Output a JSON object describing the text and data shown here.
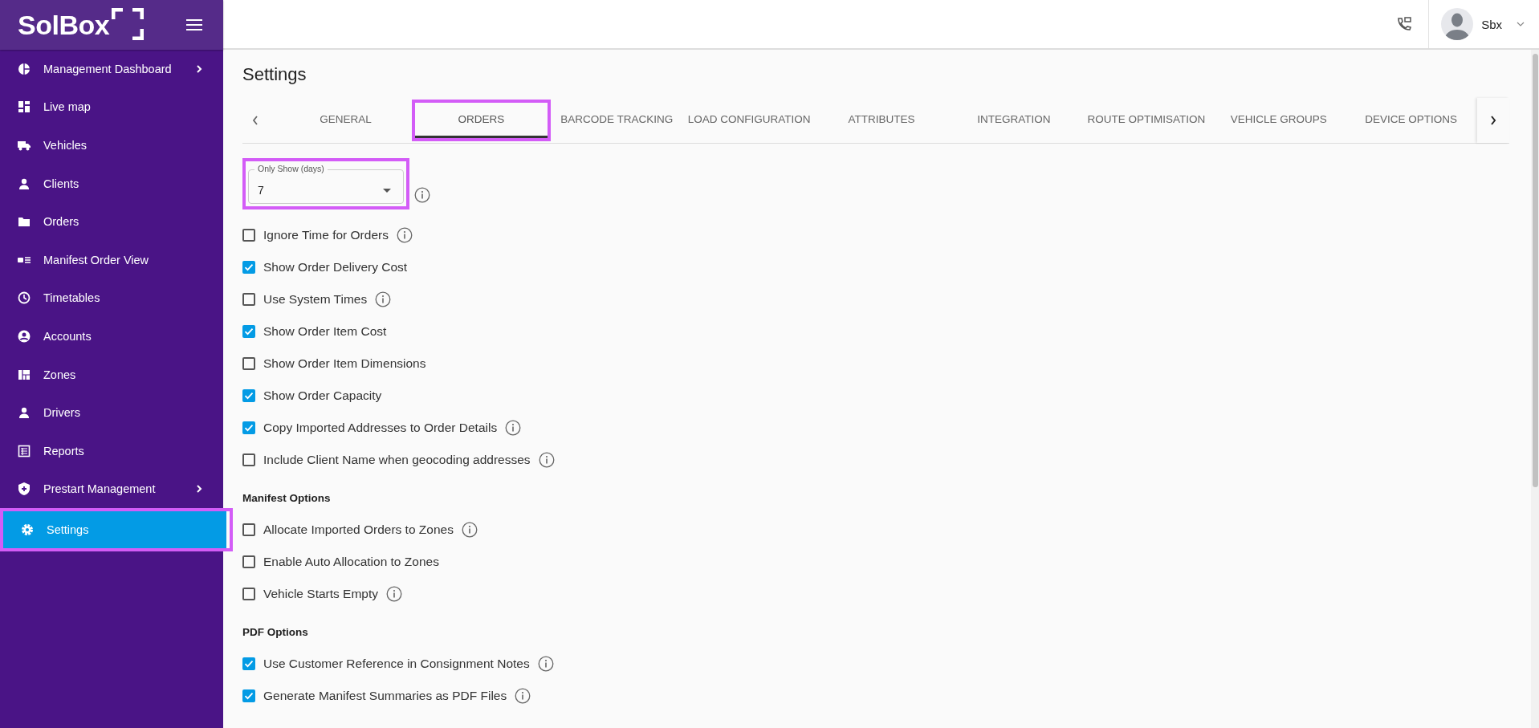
{
  "sidebar": {
    "logo": "SolBox",
    "items": [
      {
        "label": "Management Dashboard",
        "has_submenu": true,
        "selected": false,
        "highlighted": false
      },
      {
        "label": "Live map",
        "has_submenu": false,
        "selected": false,
        "highlighted": false
      },
      {
        "label": "Vehicles",
        "has_submenu": false,
        "selected": false,
        "highlighted": false
      },
      {
        "label": "Clients",
        "has_submenu": false,
        "selected": false,
        "highlighted": false
      },
      {
        "label": "Orders",
        "has_submenu": false,
        "selected": false,
        "highlighted": false
      },
      {
        "label": "Manifest Order View",
        "has_submenu": false,
        "selected": false,
        "highlighted": false
      },
      {
        "label": "Timetables",
        "has_submenu": false,
        "selected": false,
        "highlighted": false
      },
      {
        "label": "Accounts",
        "has_submenu": false,
        "selected": false,
        "highlighted": false
      },
      {
        "label": "Zones",
        "has_submenu": false,
        "selected": false,
        "highlighted": false
      },
      {
        "label": "Drivers",
        "has_submenu": false,
        "selected": false,
        "highlighted": false
      },
      {
        "label": "Reports",
        "has_submenu": false,
        "selected": false,
        "highlighted": false
      },
      {
        "label": "Prestart Management",
        "has_submenu": true,
        "selected": false,
        "highlighted": false
      },
      {
        "label": "Settings",
        "has_submenu": false,
        "selected": true,
        "highlighted": true
      }
    ]
  },
  "header": {
    "user": "Sbx"
  },
  "page": {
    "title": "Settings",
    "tabs": [
      {
        "label": "GENERAL",
        "selected": false,
        "highlighted": false
      },
      {
        "label": "ORDERS",
        "selected": true,
        "highlighted": true
      },
      {
        "label": "BARCODE TRACKING",
        "selected": false,
        "highlighted": false
      },
      {
        "label": "LOAD CONFIGURATION",
        "selected": false,
        "highlighted": false
      },
      {
        "label": "ATTRIBUTES",
        "selected": false,
        "highlighted": false
      },
      {
        "label": "INTEGRATION",
        "selected": false,
        "highlighted": false
      },
      {
        "label": "ROUTE OPTIMISATION",
        "selected": false,
        "highlighted": false
      },
      {
        "label": "VEHICLE GROUPS",
        "selected": false,
        "highlighted": false
      },
      {
        "label": "DEVICE OPTIONS",
        "selected": false,
        "highlighted": false
      }
    ],
    "only_show": {
      "label": "Only Show (days)",
      "value": "7",
      "highlighted": true
    },
    "sections": [
      {
        "options": [
          {
            "label": "Ignore Time for Orders",
            "checked": false,
            "info": true
          },
          {
            "label": "Show Order Delivery Cost",
            "checked": true,
            "info": false
          },
          {
            "label": "Use System Times",
            "checked": false,
            "info": true
          },
          {
            "label": "Show Order Item Cost",
            "checked": true,
            "info": false
          },
          {
            "label": "Show Order Item Dimensions",
            "checked": false,
            "info": false
          },
          {
            "label": "Show Order Capacity",
            "checked": true,
            "info": false
          },
          {
            "label": "Copy Imported Addresses to Order Details",
            "checked": true,
            "info": true
          },
          {
            "label": "Include Client Name when geocoding addresses",
            "checked": false,
            "info": true
          }
        ]
      },
      {
        "heading": "Manifest Options",
        "options": [
          {
            "label": "Allocate Imported Orders to Zones",
            "checked": false,
            "info": true
          },
          {
            "label": "Enable Auto Allocation to Zones",
            "checked": false,
            "info": false
          },
          {
            "label": "Vehicle Starts Empty",
            "checked": false,
            "info": true
          }
        ]
      },
      {
        "heading": "PDF Options",
        "options": [
          {
            "label": "Use Customer Reference in Consignment Notes",
            "checked": true,
            "info": true
          },
          {
            "label": "Generate Manifest Summaries as PDF Files",
            "checked": true,
            "info": true
          }
        ]
      }
    ]
  }
}
